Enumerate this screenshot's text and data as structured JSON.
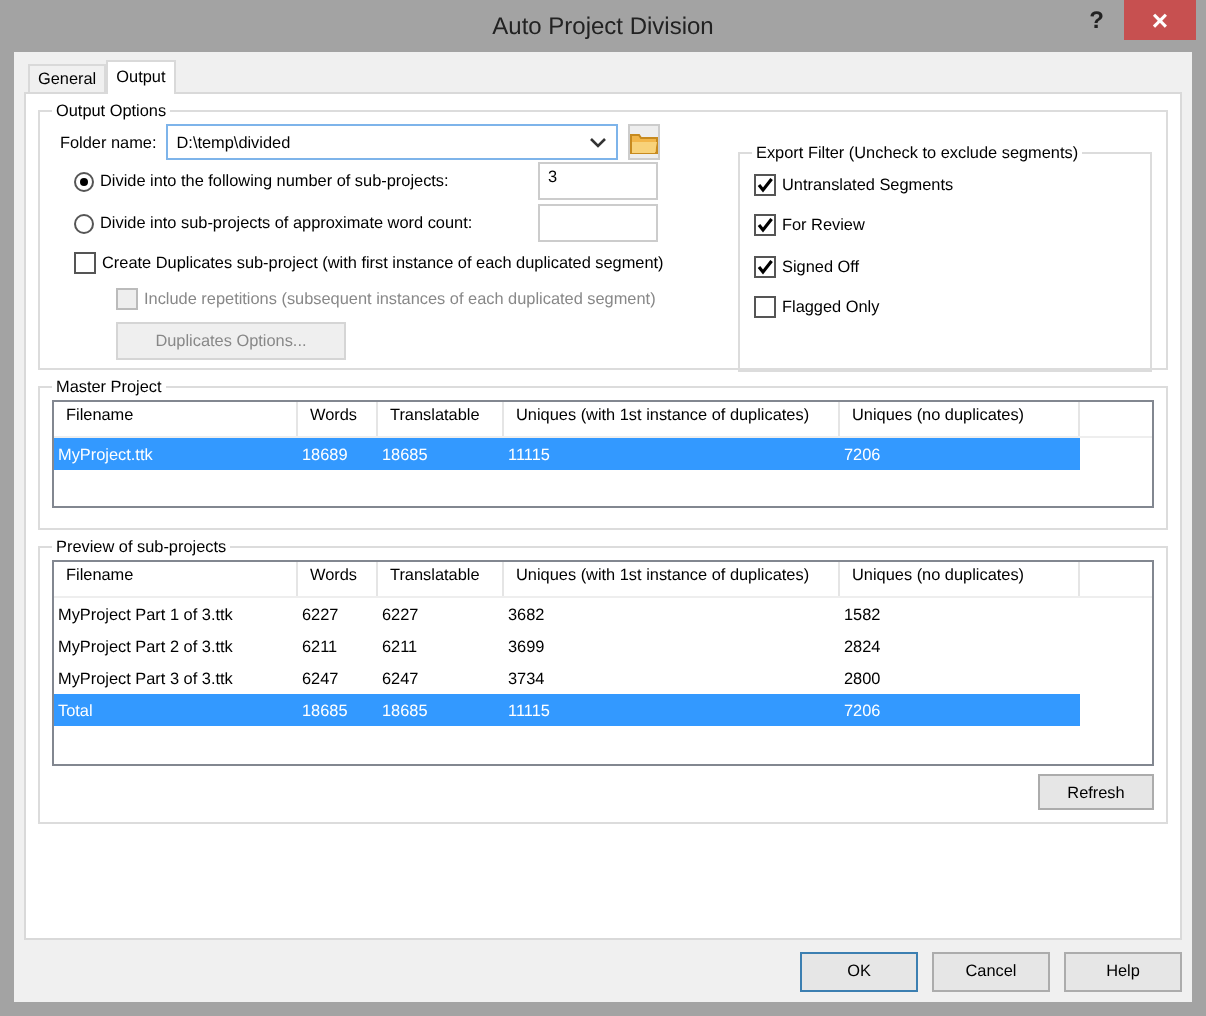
{
  "window": {
    "title": "Auto Project Division",
    "help": "?",
    "close": "×"
  },
  "tabs": [
    {
      "label": "General",
      "selected": false
    },
    {
      "label": "Output",
      "selected": true
    }
  ],
  "output_options": {
    "title": "Output Options",
    "folder_label": "Folder name:",
    "folder_value": "D:\\temp\\divided",
    "radios": [
      {
        "label": "Divide into the following number of sub-projects:",
        "selected": true,
        "value": "3"
      },
      {
        "label": "Divide into sub-projects of approximate word count:",
        "selected": false
      }
    ],
    "duplicates": {
      "label": "Create Duplicates sub-project (with first instance of each duplicated segment)",
      "checked": false
    },
    "repetitions": {
      "label": "Include repetitions (subsequent instances of each duplicated segment)",
      "checked": false,
      "disabled": true
    },
    "duplicates_button": {
      "label": "Duplicates Options...",
      "disabled": true
    }
  },
  "export_filter": {
    "title": "Export Filter (Uncheck to exclude segments)",
    "items": [
      {
        "label": "Untranslated Segments",
        "checked": true
      },
      {
        "label": "For Review",
        "checked": true
      },
      {
        "label": "Signed Off",
        "checked": true
      },
      {
        "label": "Flagged Only",
        "checked": false
      }
    ]
  },
  "master_project": {
    "title": "Master Project",
    "columns": [
      "Filename",
      "Words",
      "Translatable",
      "Uniques (with 1st instance of duplicates)",
      "Uniques (no duplicates)"
    ],
    "rows": [
      {
        "cells": [
          "MyProject.ttk",
          "18689",
          "18685",
          "11115",
          "7206"
        ],
        "selected": true
      }
    ]
  },
  "preview": {
    "title": "Preview of sub-projects",
    "columns": [
      "Filename",
      "Words",
      "Translatable",
      "Uniques (with 1st instance of duplicates)",
      "Uniques (no duplicates)"
    ],
    "rows": [
      {
        "cells": [
          "MyProject Part 1 of 3.ttk",
          "6227",
          "6227",
          "3682",
          "1582"
        ],
        "selected": false
      },
      {
        "cells": [
          "MyProject Part 2 of 3.ttk",
          "6211",
          "6211",
          "3699",
          "2824"
        ],
        "selected": false
      },
      {
        "cells": [
          "MyProject Part 3 of 3.ttk",
          "6247",
          "6247",
          "3734",
          "2800"
        ],
        "selected": false
      },
      {
        "cells": [
          "Total",
          "18685",
          "18685",
          "11115",
          "7206"
        ],
        "selected": true
      }
    ],
    "refresh": "Refresh"
  },
  "buttons": [
    {
      "label": "OK",
      "default": true
    },
    {
      "label": "Cancel",
      "default": false
    },
    {
      "label": "Help",
      "default": false
    }
  ]
}
